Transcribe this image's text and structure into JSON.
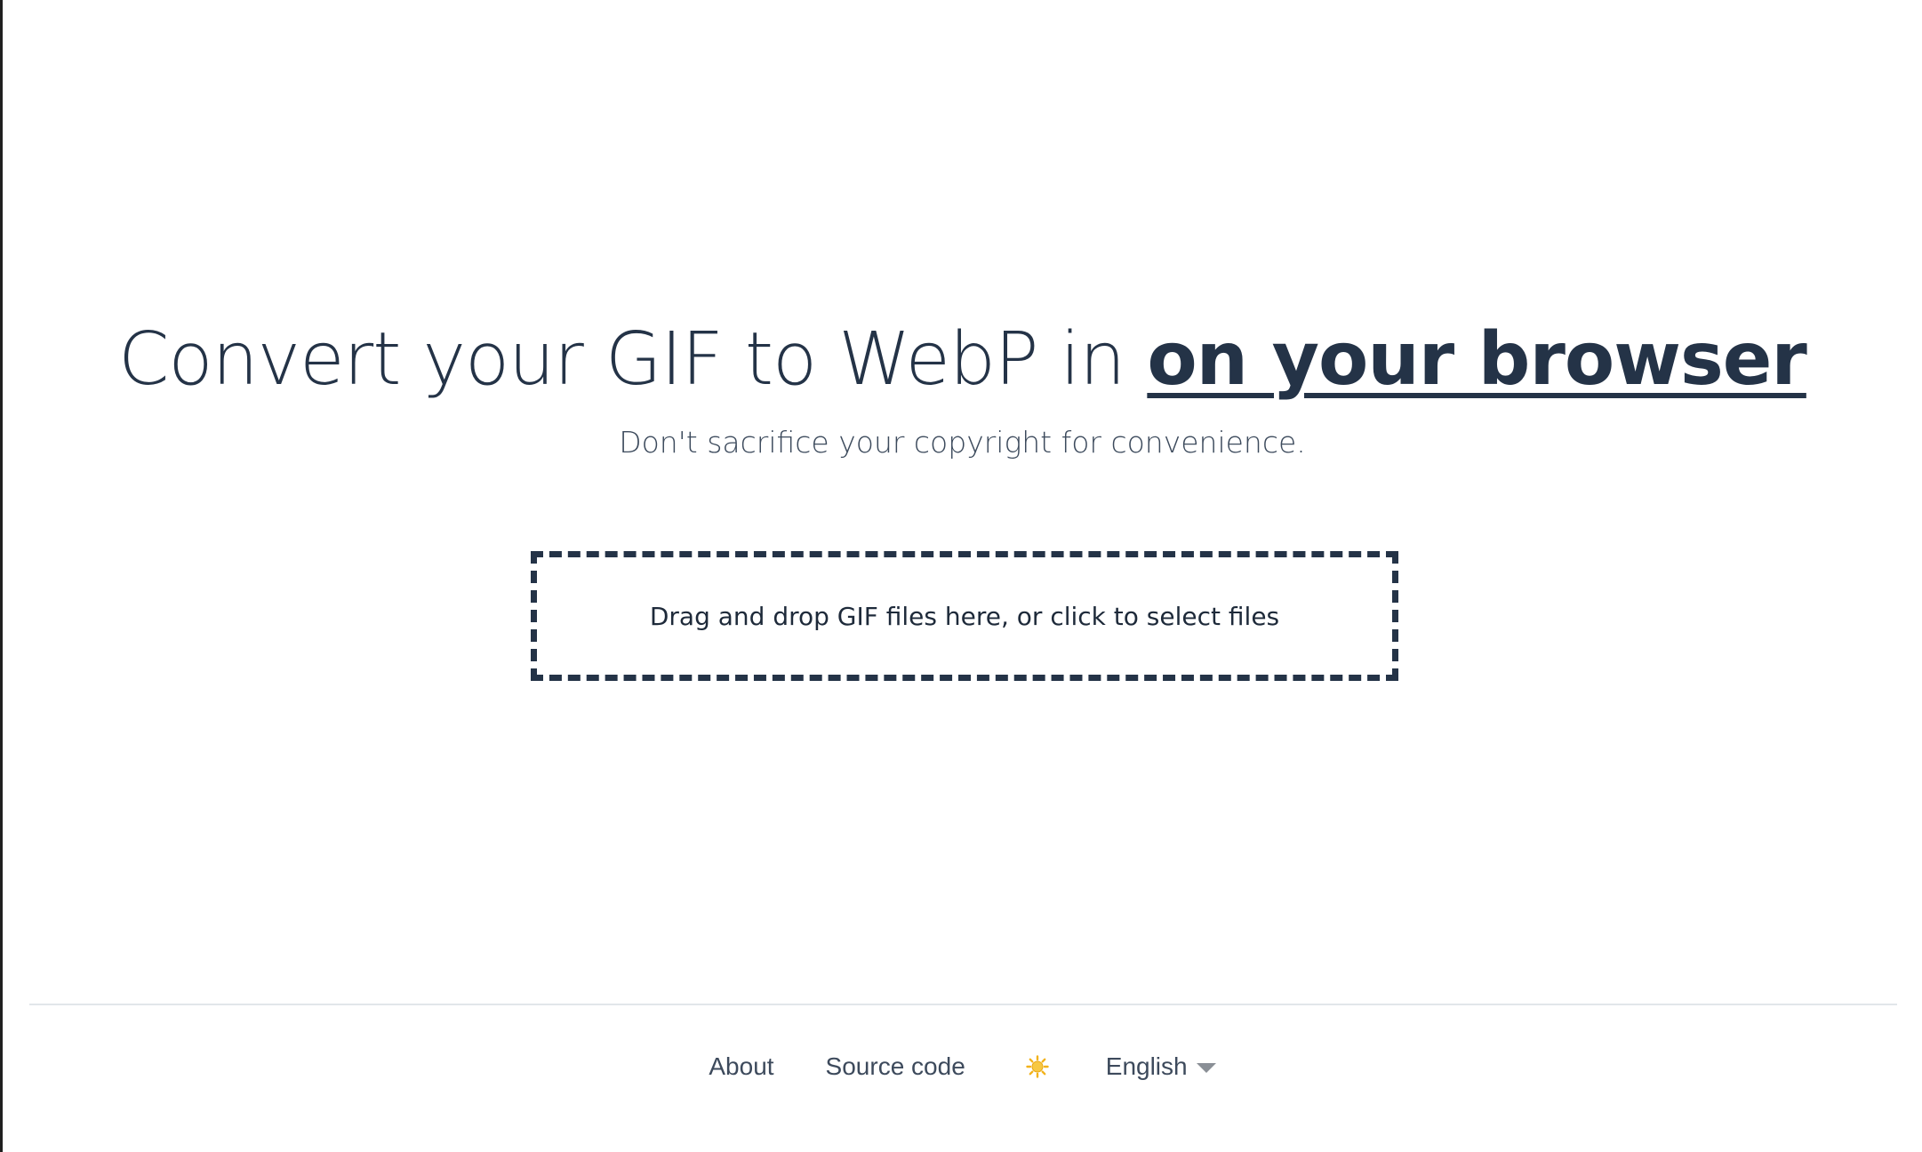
{
  "hero": {
    "headline_plain": "Convert your GIF to WebP in ",
    "headline_emphasis": "on your browser",
    "subtitle": "Don't sacrifice your copyright for convenience."
  },
  "dropzone": {
    "label": "Drag and drop GIF files here, or click to select files"
  },
  "footer": {
    "about_label": "About",
    "source_label": "Source code",
    "theme_icon": "sun-icon",
    "language_selected": "English"
  },
  "colors": {
    "text_primary": "#243347",
    "text_secondary": "#3c4a5c",
    "dropzone_border": "#243347",
    "divider": "#e2e6ea",
    "sun": "#f2b21b"
  }
}
